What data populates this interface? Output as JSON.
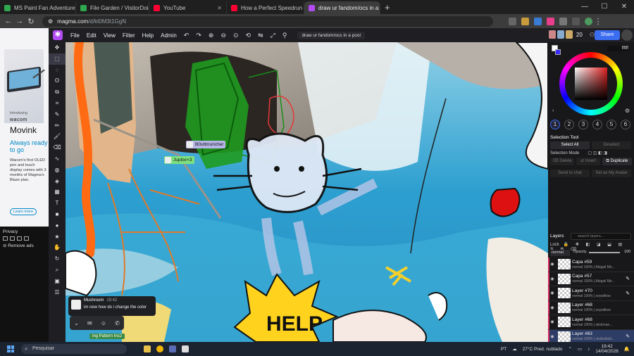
{
  "browser": {
    "tabs": [
      {
        "label": "MS Paint Fan Adventures",
        "color": "#2fa84f"
      },
      {
        "label": "File Garden / VisitorDoidoOi",
        "color": "#2fa84f"
      },
      {
        "label": "YouTube",
        "color": "#ff0033"
      },
      {
        "label": "How a Perfect Speedrun Was F",
        "color": "#ff0033"
      },
      {
        "label": "draw ur fandom/ocs in a pool",
        "color": "#b24bf3",
        "active": true
      }
    ],
    "url_domain": "magma.com",
    "url_path": "/d/kt0M3t1GgN"
  },
  "ad": {
    "intro": "Introducing",
    "brand": "wacom",
    "product": "Movink",
    "headline": "Always ready to go",
    "body": "Wacom's first OLED pen and touch display comes with 3 months of Magma's Blaze plan.",
    "cta": "Learn more"
  },
  "privacy": {
    "title": "Privacy",
    "remove_ads": "Remove ads"
  },
  "app": {
    "menus": [
      "File",
      "Edit",
      "View",
      "Filter",
      "Help",
      "Admin"
    ],
    "room_name": "draw ur fandom/ocs in a pool",
    "user_count": "20",
    "share_label": "Share"
  },
  "canvas": {
    "cursor1": "B0uttmuncher",
    "cursor2": "Jupitxr<3",
    "help_text": "HELP",
    "bottom_tag": "ing Pattern Ins2"
  },
  "chat": {
    "name": "Mushroom",
    "time": "19:42",
    "message": "im new how do i change the color"
  },
  "panel": {
    "hex": "ffffff",
    "slots": [
      "1",
      "2",
      "3",
      "4",
      "5",
      "6"
    ],
    "selection_tool": "Selection Tool",
    "select_all": "Select All",
    "deselect": "Deselect",
    "selection_mode": "Selection Mode",
    "delete": "Delete",
    "invert": "Invert",
    "duplicate": "Duplicate",
    "send_to_chat": "Send to chat",
    "set_avatar": "Set as My Avatar"
  },
  "layers": {
    "title": "Layers",
    "search_placeholder": "search layers...",
    "lock": "Lock",
    "blend": "normal",
    "opacity_label": "Opacity",
    "opacity_value": "100",
    "items": [
      {
        "name": "Capa #59",
        "sub": "normal  100% | Abigail Mir..."
      },
      {
        "name": "Capa #57",
        "sub": "normal  100% | Abigail Mir..."
      },
      {
        "name": "Layer #70",
        "sub": "normal  100% | soywillow"
      },
      {
        "name": "Layer #68",
        "sub": "normal  100% | soywillow"
      },
      {
        "name": "Layer #68",
        "sub": "normal  100% | stickman..."
      },
      {
        "name": "Layer #63",
        "sub": "normal  100% | visitordoid...",
        "selected": true
      }
    ]
  },
  "taskbar": {
    "search": "Pesquisar",
    "lang": "PT",
    "weather": "27°C  Pred. nublado",
    "time": "19:42",
    "date": "14/04/2026"
  }
}
